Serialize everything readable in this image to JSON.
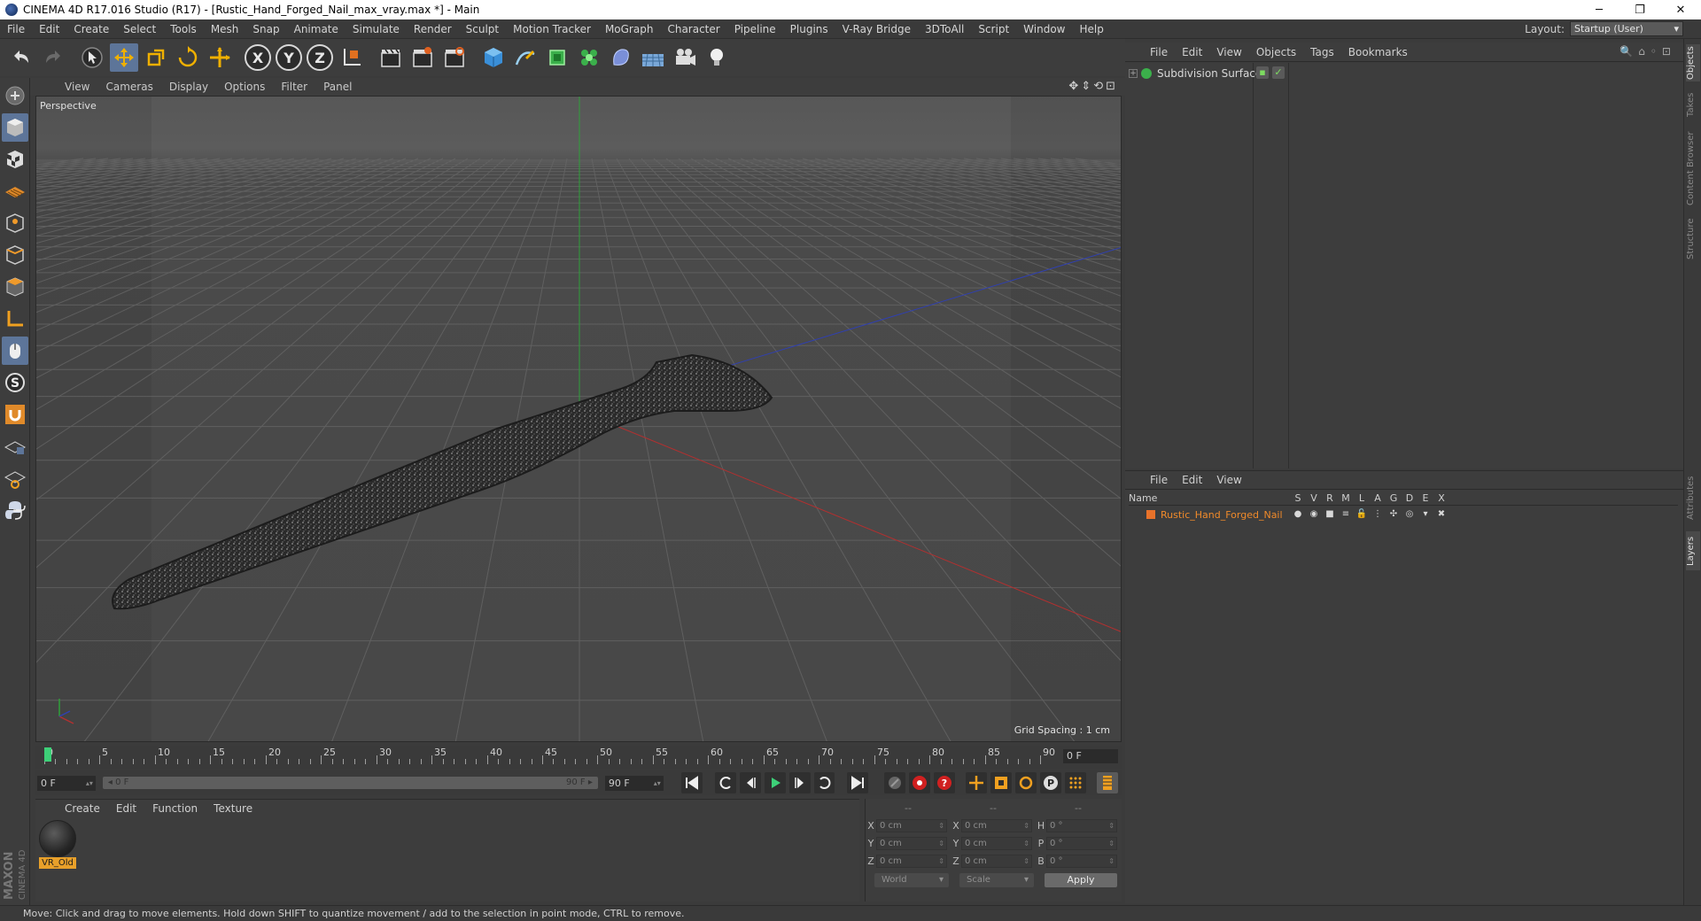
{
  "window": {
    "title": "CINEMA 4D R17.016 Studio (R17) - [Rustic_Hand_Forged_Nail_max_vray.max *] - Main",
    "controls": [
      "─",
      "❐",
      "✕"
    ]
  },
  "menubar": {
    "items": [
      "File",
      "Edit",
      "Create",
      "Select",
      "Tools",
      "Mesh",
      "Snap",
      "Animate",
      "Simulate",
      "Render",
      "Sculpt",
      "Motion Tracker",
      "MoGraph",
      "Character",
      "Pipeline",
      "Plugins",
      "V-Ray Bridge",
      "3DToAll",
      "Script",
      "Window",
      "Help"
    ],
    "layout_label": "Layout:",
    "layout_value": "Startup (User)"
  },
  "toolbar": {
    "axis_buttons": [
      "X",
      "Y",
      "Z"
    ]
  },
  "viewport": {
    "menu": [
      "View",
      "Cameras",
      "Display",
      "Options",
      "Filter",
      "Panel"
    ],
    "label": "Perspective",
    "grid_spacing": "Grid Spacing : 1 cm",
    "nav_icons": "✥⇕⟲⊡"
  },
  "timeline": {
    "ticks": [
      "0",
      "5",
      "10",
      "15",
      "20",
      "25",
      "30",
      "35",
      "40",
      "45",
      "50",
      "55",
      "60",
      "65",
      "70",
      "75",
      "80",
      "85",
      "90"
    ],
    "end_field": "0 F",
    "current_frame": "0 F",
    "range_start": "◂ 0 F",
    "range_end": "90 F ▸",
    "max_frame": "90 F"
  },
  "material_manager": {
    "menu": [
      "Create",
      "Edit",
      "Function",
      "Texture"
    ],
    "materials": [
      {
        "name": "VR_Old"
      }
    ]
  },
  "coordinates": {
    "headers": [
      "--",
      "--",
      "--"
    ],
    "rows": [
      {
        "a": "X",
        "av": "0 cm",
        "b": "X",
        "bv": "0 cm",
        "c": "H",
        "cv": "0 °"
      },
      {
        "a": "Y",
        "av": "0 cm",
        "b": "Y",
        "bv": "0 cm",
        "c": "P",
        "cv": "0 °"
      },
      {
        "a": "Z",
        "av": "0 cm",
        "b": "Z",
        "bv": "0 cm",
        "c": "B",
        "cv": "0 °"
      }
    ],
    "mode1": "World",
    "mode2": "Scale",
    "apply": "Apply"
  },
  "object_manager": {
    "menu": [
      "File",
      "Edit",
      "View",
      "Objects",
      "Tags",
      "Bookmarks"
    ],
    "objects": [
      {
        "name": "Subdivision Surface"
      }
    ]
  },
  "layer_manager": {
    "menu": [
      "File",
      "Edit",
      "View"
    ],
    "columns": [
      "Name",
      "S",
      "V",
      "R",
      "M",
      "L",
      "A",
      "G",
      "D",
      "E",
      "X"
    ],
    "layers": [
      {
        "name": "Rustic_Hand_Forged_Nail"
      }
    ]
  },
  "right_tabs": [
    "Objects",
    "Takes",
    "Content Browser",
    "Structure",
    "Attributes",
    "Layers"
  ],
  "status": "Move: Click and drag to move elements. Hold down SHIFT to quantize movement / add to the selection in point mode, CTRL to remove.",
  "branding": {
    "logo_text": "MAXON CINEMA 4D"
  },
  "colors": {
    "accent": "#5d7599",
    "layer_color": "#e8722a",
    "playhead": "#3dd078"
  }
}
